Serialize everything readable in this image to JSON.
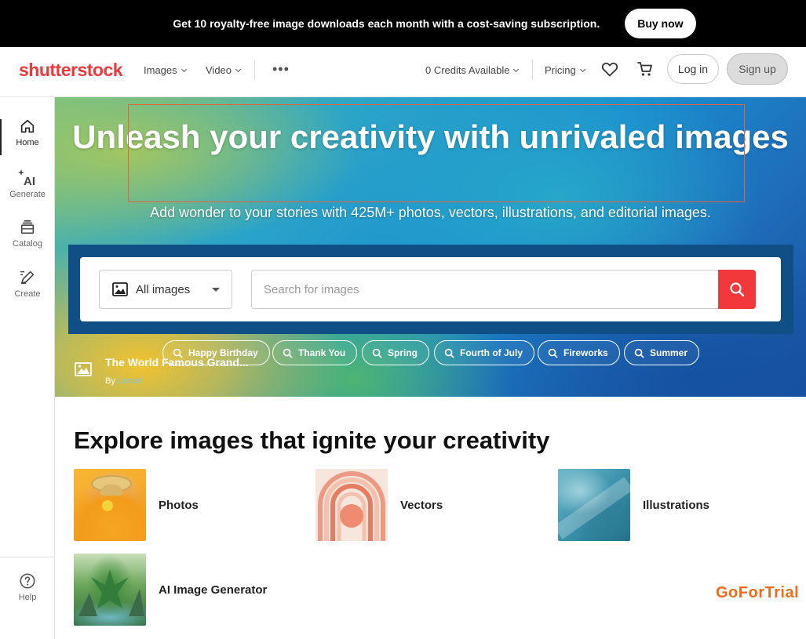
{
  "promo": {
    "text": "Get 10 royalty-free image downloads each month with a cost-saving subscription.",
    "button": "Buy now"
  },
  "header": {
    "logo": "shutterstock",
    "nav": [
      "Images",
      "Video"
    ],
    "more_icon": "more-horizontal-icon",
    "credits": "0 Credits Available",
    "pricing": "Pricing",
    "login": "Log in",
    "signup": "Sign up"
  },
  "sidebar": {
    "items": [
      {
        "label": "Home",
        "icon": "home-icon",
        "active": true
      },
      {
        "label": "Generate",
        "icon": "ai-sparkle-icon"
      },
      {
        "label": "Catalog",
        "icon": "catalog-icon"
      },
      {
        "label": "Create",
        "icon": "edit-icon"
      }
    ],
    "help": "Help"
  },
  "hero": {
    "title": "Unleash your creativity with unrivaled images",
    "subtitle": "Add wonder to your stories with 425M+ photos, vectors, illustrations, and editorial images.",
    "search": {
      "type_label": "All images",
      "placeholder": "Search for images"
    },
    "chips": [
      "Happy Birthday",
      "Thank You",
      "Spring",
      "Fourth of July",
      "Fireworks",
      "Summer"
    ],
    "credit": {
      "title": "The World Famous Grand...",
      "by": "By",
      "author": "Lorcel"
    }
  },
  "explore": {
    "title": "Explore images that ignite your creativity",
    "categories": [
      {
        "label": "Photos"
      },
      {
        "label": "Vectors"
      },
      {
        "label": "Illustrations"
      },
      {
        "label": "AI Image Generator"
      }
    ]
  },
  "watermark": "GoForTrial",
  "colors": {
    "brand": "#f2383a",
    "promo_bg": "#000000",
    "search_band": "#0f4f85",
    "watermark": "#f26a1b"
  }
}
